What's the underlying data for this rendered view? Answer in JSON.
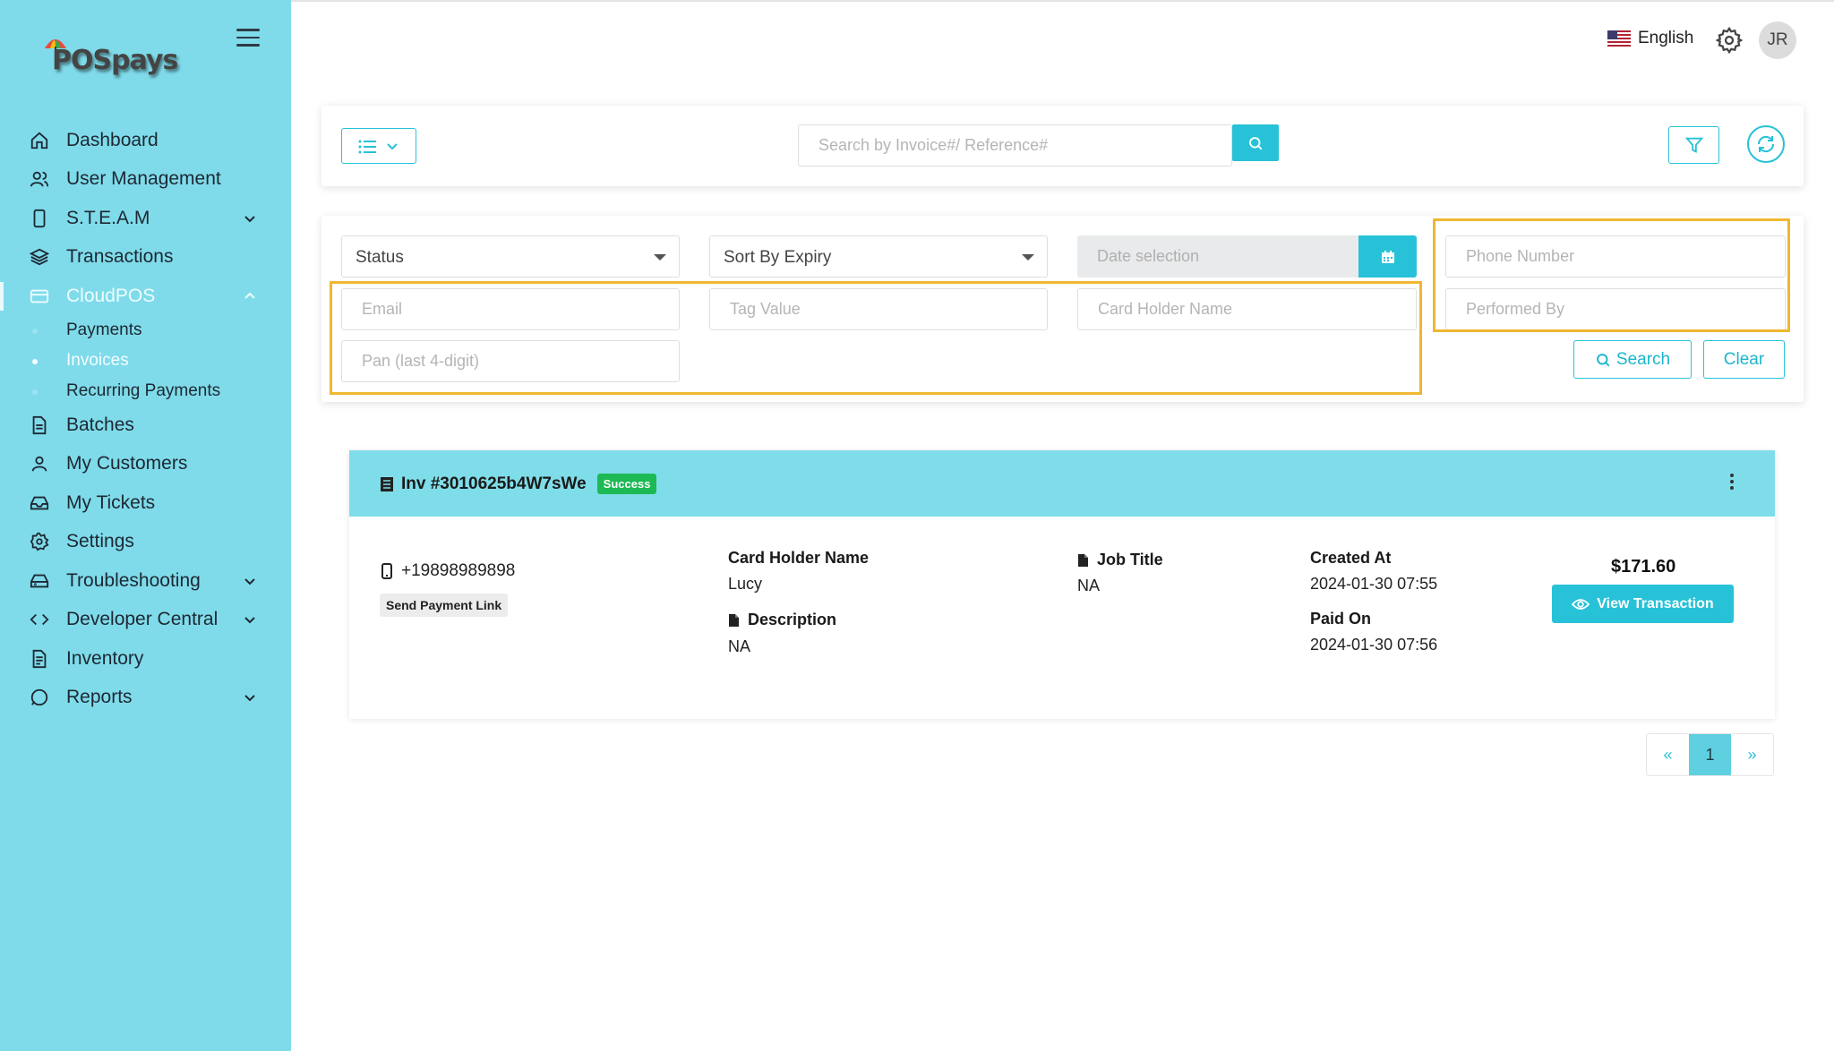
{
  "brand": {
    "logo_text": "POSpays"
  },
  "sidebar": {
    "items": [
      {
        "label": "Dashboard",
        "icon": "home-icon",
        "chevron": false
      },
      {
        "label": "User Management",
        "icon": "users-icon",
        "chevron": false
      },
      {
        "label": "S.T.E.A.M",
        "icon": "device-icon",
        "chevron": true
      },
      {
        "label": "Transactions",
        "icon": "layers-icon",
        "chevron": false
      },
      {
        "label": "CloudPOS",
        "icon": "card-icon",
        "chevron": true,
        "expanded": true,
        "active": true
      },
      {
        "label": "Batches",
        "icon": "file-icon",
        "chevron": false
      },
      {
        "label": "My Customers",
        "icon": "user-icon",
        "chevron": false
      },
      {
        "label": "My Tickets",
        "icon": "inbox-icon",
        "chevron": false
      },
      {
        "label": "Settings",
        "icon": "gear-icon",
        "chevron": false
      },
      {
        "label": "Troubleshooting",
        "icon": "drive-icon",
        "chevron": true
      },
      {
        "label": "Developer Central",
        "icon": "code-icon",
        "chevron": true
      },
      {
        "label": "Inventory",
        "icon": "document-icon",
        "chevron": false
      },
      {
        "label": "Reports",
        "icon": "chat-icon",
        "chevron": true
      }
    ],
    "subitems": [
      {
        "label": "Payments",
        "active": false
      },
      {
        "label": "Invoices",
        "active": true
      },
      {
        "label": "Recurring Payments",
        "active": false
      }
    ]
  },
  "topbar": {
    "language": "English",
    "avatar_initials": "JR"
  },
  "search": {
    "placeholder": "Search by Invoice#/ Reference#"
  },
  "filters": {
    "status": "Status",
    "sort": "Sort By Expiry",
    "date_placeholder": "Date selection",
    "phone_placeholder": "Phone Number",
    "email_placeholder": "Email",
    "tag_placeholder": "Tag Value",
    "cardholder_placeholder": "Card Holder Name",
    "performed_by_placeholder": "Performed By",
    "pan_placeholder": "Pan (last 4-digit)",
    "search_label": "Search",
    "clear_label": "Clear"
  },
  "invoice": {
    "title": "Inv #3010625b4W7sWe",
    "status": "Success",
    "phone": "+19898989898",
    "send_link_label": "Send Payment Link",
    "card_holder_label": "Card Holder Name",
    "card_holder_value": "Lucy",
    "description_label": "Description",
    "description_value": "NA",
    "job_title_label": "Job Title",
    "job_title_value": "NA",
    "created_at_label": "Created At",
    "created_at_value": "2024-01-30 07:55",
    "paid_on_label": "Paid On",
    "paid_on_value": "2024-01-30 07:56",
    "amount": "$171.60",
    "view_label": "View Transaction"
  },
  "pagination": {
    "prev": "«",
    "current": "1",
    "next": "»"
  },
  "colors": {
    "sidebar": "#7fdbea",
    "accent": "#27c2d8",
    "highlight": "#efb732",
    "success": "#1db954"
  }
}
